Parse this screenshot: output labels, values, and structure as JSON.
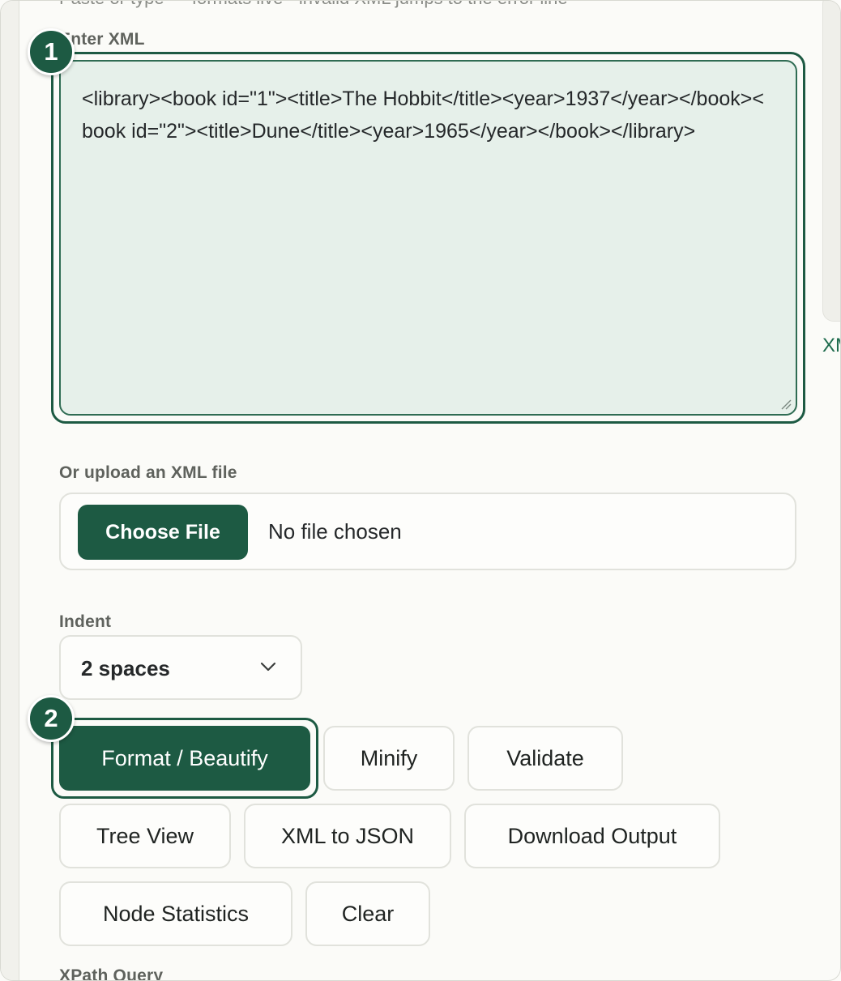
{
  "top_hint": "Paste or type — formats live · invalid XML jumps to the error line",
  "right_peek": "XML",
  "input_section": {
    "label": "Enter XML",
    "value": "<library><book id=\"1\"><title>The Hobbit</title><year>1937</year></book><book id=\"2\"><title>Dune</title><year>1965</year></book></library>",
    "step_badge": "1"
  },
  "upload_section": {
    "label": "Or upload an XML file",
    "button_label": "Choose File",
    "status": "No file chosen"
  },
  "indent_section": {
    "label": "Indent",
    "selected": "2 spaces",
    "icon": "chevron-down-icon"
  },
  "actions": {
    "step_badge": "2",
    "format_label": "Format / Beautify",
    "minify_label": "Minify",
    "validate_label": "Validate",
    "tree_view_label": "Tree View",
    "xml_to_json_label": "XML to JSON",
    "download_label": "Download Output",
    "node_stats_label": "Node Statistics",
    "clear_label": "Clear"
  },
  "xpath_section": {
    "label": "XPath Query"
  },
  "colors": {
    "accent": "#1d5a43",
    "input_background": "#e6f0ea",
    "page_background": "#fbfbf8",
    "border": "#e1e2dc"
  }
}
